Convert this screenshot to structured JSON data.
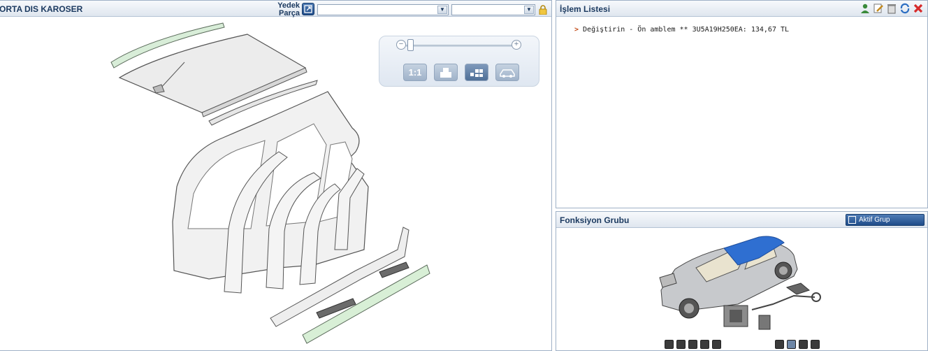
{
  "left_panel": {
    "title": "ORTA DIS KAROSER",
    "yedek_parca_label": "Yedek Parça",
    "select_1_value": "",
    "select_2_value": "",
    "zoom": {
      "btn_1_1": "1:1",
      "level": 0.05
    }
  },
  "right_top": {
    "title": "İşlem Listesi",
    "operations": [
      {
        "marker": ">",
        "text": "Değiştirin - Ön amblem ** 3U5A19H250EA: 134,67 TL"
      }
    ],
    "toolbar_icons": [
      "user-icon",
      "edit-icon",
      "trash-icon",
      "refresh-icon",
      "close-icon"
    ]
  },
  "right_bottom": {
    "title": "Fonksiyon Grubu",
    "aktif_grup_label": "Aktif Grup",
    "group_icons": [
      "body-icon",
      "interior-icon",
      "door-icon",
      "engine-icon",
      "suspension-icon",
      "electrical-icon",
      "cooling-icon",
      "brake-icon",
      "wheel-icon"
    ]
  },
  "colors": {
    "header_text": "#1c3a60",
    "accent_blue": "#1f4c8a",
    "highlight_green": "#cfe8cf",
    "car_roof_blue": "#2f6fd1"
  }
}
